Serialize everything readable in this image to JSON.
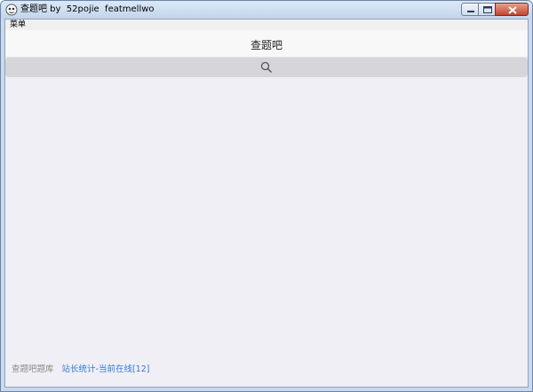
{
  "window": {
    "title": "查题吧 by  52pojie  featmellwo"
  },
  "menubar": {
    "menu_label": "菜单"
  },
  "header": {
    "title": "查题吧"
  },
  "search": {
    "icon": "search-icon"
  },
  "footer": {
    "label": "查题吧题库",
    "stats_link": "站长统计-当前在线[12]"
  },
  "colors": {
    "content_bg": "#f0eff5",
    "search_bar_bg": "#d6d5da",
    "link": "#2f7ad8",
    "muted_text": "#8a8a8a"
  }
}
